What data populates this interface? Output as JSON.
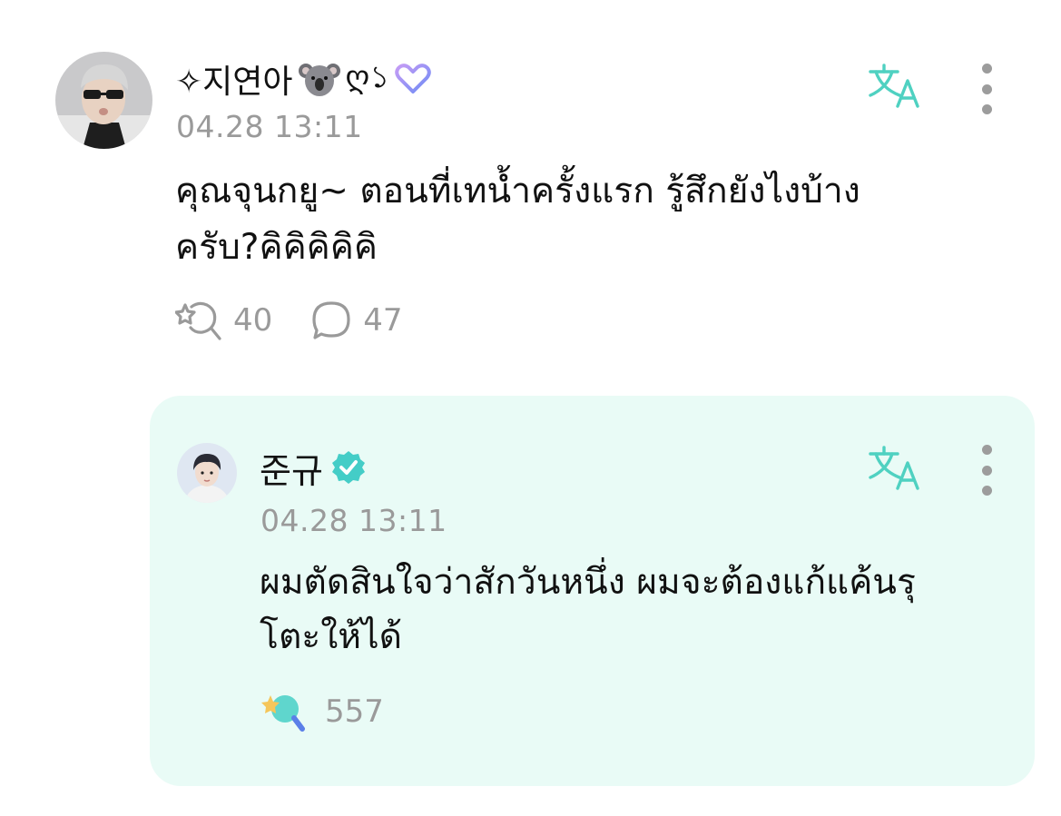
{
  "comment": {
    "author": "✧지연아",
    "author_suffix": "ღ১",
    "icons": [
      "koala-icon",
      "heart-badge-icon"
    ],
    "timestamp": "04.28 13:11",
    "text_line1": "คุณจุนกยู~ ตอนที่เทน้ำครั้งแรก รู้สึกยังไงบ้าง",
    "text_line2": "ครับ?คิคิคิคิคิ",
    "like_count": "40",
    "reply_count": "47"
  },
  "reply": {
    "author": "준규",
    "verified": true,
    "timestamp": "04.28 13:11",
    "text_line1": "ผมตัดสินใจว่าสักวันหนึ่ง ผมจะต้องแก้แค้นรุ",
    "text_line2": "โตะให้ได้",
    "like_count": "557"
  },
  "colors": {
    "accent": "#4fd1c1",
    "reply_background": "#e9fbf6",
    "muted_text": "#9a9a9a",
    "verified_badge": "#44cdc7"
  }
}
